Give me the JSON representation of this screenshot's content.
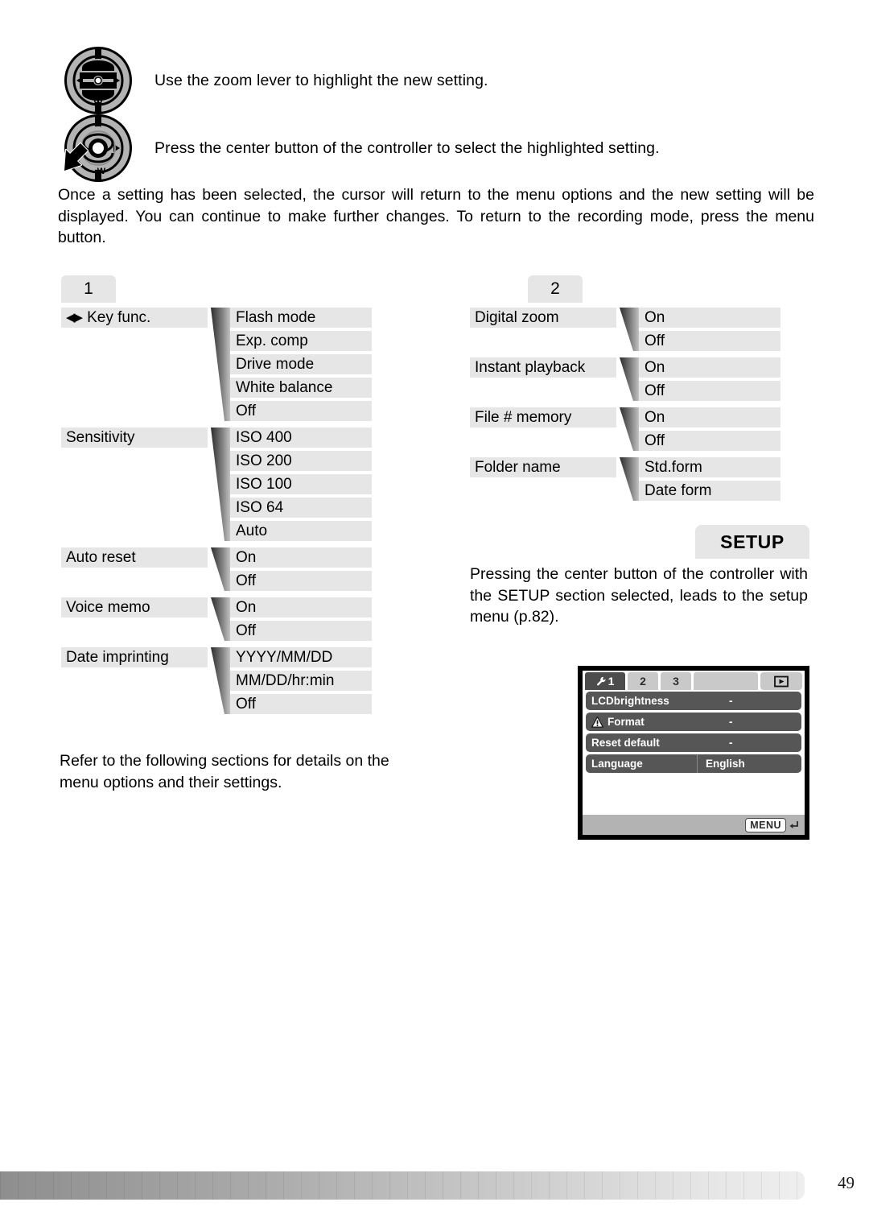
{
  "instructions": [
    {
      "icon": "controller-zoom-lever-icon",
      "text": "Use the zoom lever to highlight the new setting."
    },
    {
      "icon": "controller-center-button-icon",
      "text": "Press the center button of the controller to select the highlighted setting."
    }
  ],
  "intro_paragraph": "Once a setting has been selected, the cursor will return to the menu options and the new setting will be displayed. You can continue to make further changes. To return to the recording mode, press the menu button.",
  "menu_columns": [
    {
      "tab_label": "1",
      "groups": [
        {
          "label": "Key func.",
          "has_lr_arrows": true,
          "options": [
            "Flash mode",
            "Exp. comp",
            "Drive mode",
            "White balance",
            "Off"
          ]
        },
        {
          "label": "Sensitivity",
          "has_lr_arrows": false,
          "options": [
            "ISO 400",
            "ISO 200",
            "ISO 100",
            "ISO 64",
            "Auto"
          ]
        },
        {
          "label": "Auto reset",
          "has_lr_arrows": false,
          "options": [
            "On",
            "Off"
          ]
        },
        {
          "label": "Voice memo",
          "has_lr_arrows": false,
          "options": [
            "On",
            "Off"
          ]
        },
        {
          "label": "Date imprinting",
          "has_lr_arrows": false,
          "options": [
            "YYYY/MM/DD",
            "MM/DD/hr:min",
            "Off"
          ]
        }
      ]
    },
    {
      "tab_label": "2",
      "groups": [
        {
          "label": "Digital zoom",
          "has_lr_arrows": false,
          "options": [
            "On",
            "Off"
          ]
        },
        {
          "label": "Instant playback",
          "has_lr_arrows": false,
          "options": [
            "On",
            "Off"
          ]
        },
        {
          "label": "File # memory",
          "has_lr_arrows": false,
          "options": [
            "On",
            "Off"
          ]
        },
        {
          "label": "Folder name",
          "has_lr_arrows": false,
          "options": [
            "Std.form",
            "Date form"
          ]
        }
      ]
    }
  ],
  "setup": {
    "tab_label": "SETUP",
    "paragraph": "Pressing the center button of the controller with the SETUP section selected, leads to the  setup menu (p.82)."
  },
  "refer_paragraph": "Refer to the following sections for details on the menu options and their settings.",
  "lcd": {
    "tabs": [
      {
        "label": "1",
        "icon": "wrench-icon",
        "active": true
      },
      {
        "label": "2",
        "icon": null,
        "active": false
      },
      {
        "label": "3",
        "icon": null,
        "active": false
      }
    ],
    "playback_button_icon": "playback-icon",
    "rows": [
      {
        "label": "LCDbrightness",
        "value": "-",
        "icon": null
      },
      {
        "label": "Format",
        "value": "-",
        "icon": "warning-triangle-icon"
      },
      {
        "label": "Reset default",
        "value": "-",
        "icon": null
      },
      {
        "label": "Language",
        "value": "English",
        "icon": null
      }
    ],
    "footer_button": "MENU",
    "footer_button_icon": "return-arrow-icon"
  },
  "page_number": "49",
  "colors": {
    "menu_box": "#e6e6e6",
    "lcd_row": "#565656",
    "lcd_tab_inactive": "#c9c9c9",
    "lcd_tab_active": "#4c4c4c",
    "lcd_footer": "#b3b3b3"
  }
}
